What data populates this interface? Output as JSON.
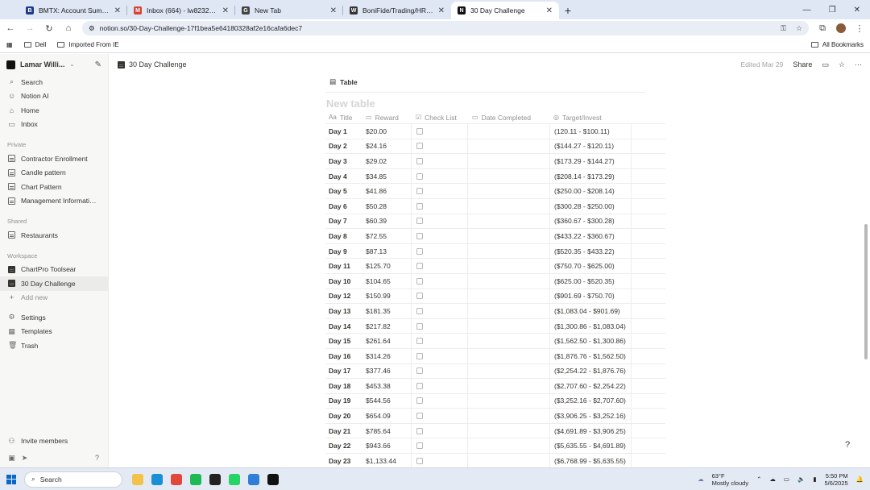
{
  "browser": {
    "tabs": [
      {
        "label": "BMTX: Account Summary",
        "icon": "bmtx-favicon",
        "color": "#1f3b8a",
        "glyph": "B"
      },
      {
        "label": "Inbox (664) - lw82325@gmail.c...",
        "icon": "gmail-favicon",
        "color": "#d44638",
        "glyph": "M"
      },
      {
        "label": "New Tab",
        "icon": "chrome-favicon",
        "color": "#444444",
        "glyph": "G"
      },
      {
        "label": "BoniFide/Trading/HR | Whop",
        "icon": "whop-favicon",
        "color": "#333333",
        "glyph": "W"
      },
      {
        "label": "30 Day Challenge",
        "icon": "notion-favicon",
        "color": "#111111",
        "glyph": "N"
      }
    ],
    "url": "notion.so/30-Day-Challenge-17f1bea5e64180328af2e16cafa6dec7",
    "bookmarks": [
      "Dell",
      "Imported From IE"
    ],
    "all_bookmarks": "All Bookmarks"
  },
  "sidebar": {
    "workspace": "Lamar Willi...",
    "top_items": [
      {
        "label": "Search",
        "icon": "search-icon",
        "glyph": "⌕"
      },
      {
        "label": "Notion AI",
        "icon": "notion-ai-icon",
        "glyph": "☺"
      },
      {
        "label": "Home",
        "icon": "home-icon",
        "glyph": "⌂"
      },
      {
        "label": "Inbox",
        "icon": "inbox-icon",
        "glyph": "▭"
      }
    ],
    "private_heading": "Private",
    "private_items": [
      "Contractor Enrollment",
      "Candle pattern",
      "Chart Pattern",
      "Management Information ..."
    ],
    "shared_heading": "Shared",
    "shared_items": [
      "Restaurants"
    ],
    "workspace_heading": "Workspace",
    "workspace_items": [
      "ChartPro Toolsear",
      "30 Day Challenge"
    ],
    "add_new": "Add new",
    "bottom_items": [
      {
        "label": "Settings",
        "icon": "settings-icon",
        "glyph": "⚙"
      },
      {
        "label": "Templates",
        "icon": "templates-icon",
        "glyph": "▦"
      },
      {
        "label": "Trash",
        "icon": "trash-icon",
        "glyph": "🗑"
      }
    ],
    "invite": "Invite members"
  },
  "topbar": {
    "page_title": "30 Day Challenge",
    "edited": "Edited Mar 29",
    "share": "Share"
  },
  "database": {
    "view_label": "Table",
    "title_placeholder": "New table",
    "columns": [
      "Title",
      "Reward",
      "Check List",
      "Date Completed",
      "Target/Invest"
    ],
    "rows": [
      {
        "title": "Day 1",
        "reward": "$20.00",
        "target": "(120.11 - $100.11)"
      },
      {
        "title": "Day 2",
        "reward": "$24.16",
        "target": "($144.27 - $120.11)"
      },
      {
        "title": "Day 3",
        "reward": "$29.02",
        "target": "($173.29 - $144.27)"
      },
      {
        "title": "Day 4",
        "reward": "$34.85",
        "target": "($208.14 - $173.29)"
      },
      {
        "title": "Day 5",
        "reward": "$41.86",
        "target": "($250.00 - $208.14)"
      },
      {
        "title": "Day 6",
        "reward": "$50.28",
        "target": "($300.28 - $250.00)"
      },
      {
        "title": "Day 7",
        "reward": "$60.39",
        "target": "($360.67 - $300.28)"
      },
      {
        "title": "Day 8",
        "reward": "$72.55",
        "target": "($433.22 - $360.67)"
      },
      {
        "title": "Day 9",
        "reward": "$87.13",
        "target": "($520.35 - $433.22)"
      },
      {
        "title": "Day 11",
        "reward": "$125.70",
        "target": "($750.70 - $625.00)"
      },
      {
        "title": "Day 10",
        "reward": "$104.65",
        "target": "($625.00 - $520.35)"
      },
      {
        "title": "Day 12",
        "reward": "$150.99",
        "target": "($901.69 - $750.70)"
      },
      {
        "title": "Day 13",
        "reward": "$181.35",
        "target": "($1,083.04 - $901.69)"
      },
      {
        "title": "Day 14",
        "reward": "$217.82",
        "target": "($1,300.86 - $1,083.04)"
      },
      {
        "title": "Day 15",
        "reward": "$261.64",
        "target": "($1,562.50 - $1,300.86)"
      },
      {
        "title": "Day 16",
        "reward": "$314.26",
        "target": "($1,876.76 - $1,562.50)"
      },
      {
        "title": "Day 17",
        "reward": "$377.46",
        "target": "($2,254.22 - $1,876.76)"
      },
      {
        "title": "Day 18",
        "reward": "$453.38",
        "target": "($2,707.60 - $2,254.22)"
      },
      {
        "title": "Day 19",
        "reward": "$544.56",
        "target": "($3,252.16 - $2,707.60)"
      },
      {
        "title": "Day 20",
        "reward": "$654.09",
        "target": "($3,906.25 - $3,252.16)"
      },
      {
        "title": "Day 21",
        "reward": "$785.64",
        "target": "($4,691.89 - $3,906.25)"
      },
      {
        "title": "Day 22",
        "reward": "$943.66",
        "target": "($5,635.55 - $4,691.89)"
      },
      {
        "title": "Day 23",
        "reward": "$1,133.44",
        "target": "($6,768.99 - $5,635.55)"
      }
    ]
  },
  "taskbar": {
    "search": "Search",
    "weather_temp": "63°F",
    "weather_desc": "Mostly cloudy",
    "time": "5:50 PM",
    "date": "5/6/2025",
    "apps": [
      {
        "icon": "file-explorer-icon",
        "color": "#f3c24a"
      },
      {
        "icon": "edge-icon",
        "color": "#1a8fd6"
      },
      {
        "icon": "chrome-icon",
        "color": "#e2473b"
      },
      {
        "icon": "spotify-icon",
        "color": "#1db954"
      },
      {
        "icon": "tradingview-icon",
        "color": "#222222"
      },
      {
        "icon": "whatsapp-icon",
        "color": "#25d366"
      },
      {
        "icon": "app-icon",
        "color": "#2f7fd8"
      },
      {
        "icon": "tradingview-desktop-icon",
        "color": "#111111"
      }
    ]
  }
}
